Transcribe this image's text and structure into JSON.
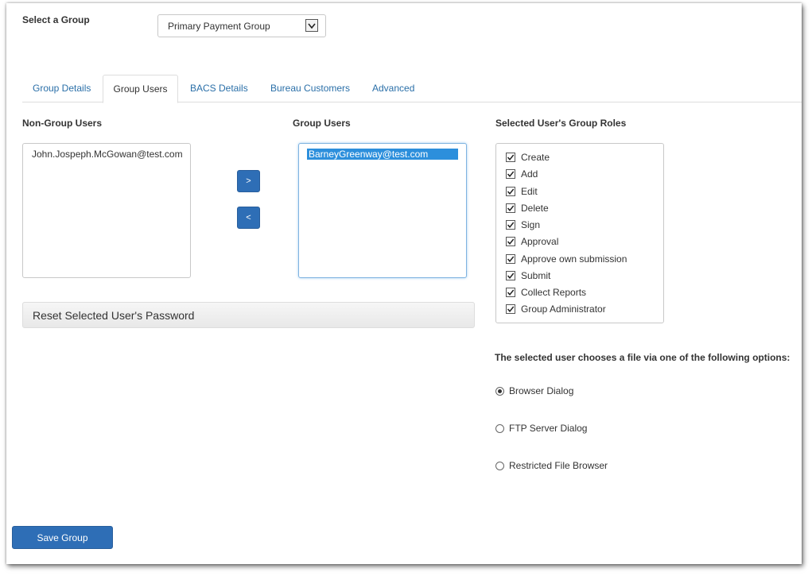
{
  "group_select": {
    "label": "Select a Group",
    "value": "Primary Payment Group"
  },
  "tabs": [
    {
      "label": "Group Details",
      "active": false
    },
    {
      "label": "Group Users",
      "active": true
    },
    {
      "label": "BACS Details",
      "active": false
    },
    {
      "label": "Bureau Customers",
      "active": false
    },
    {
      "label": "Advanced",
      "active": false
    }
  ],
  "non_group_users": {
    "heading": "Non-Group Users",
    "items": [
      "John.Jospeph.McGowan@test.com"
    ]
  },
  "move_buttons": {
    "add": ">",
    "remove": "<"
  },
  "group_users": {
    "heading": "Group Users",
    "items": [
      "BarneyGreenway@test.com"
    ],
    "selected_index": 0
  },
  "reset_password": {
    "label": "Reset Selected User's Password"
  },
  "roles": {
    "heading": "Selected User's Group Roles",
    "items": [
      {
        "label": "Create",
        "checked": true
      },
      {
        "label": "Add",
        "checked": true
      },
      {
        "label": "Edit",
        "checked": true
      },
      {
        "label": "Delete",
        "checked": true
      },
      {
        "label": "Sign",
        "checked": true
      },
      {
        "label": "Approval",
        "checked": true
      },
      {
        "label": "Approve own submission",
        "checked": true
      },
      {
        "label": "Submit",
        "checked": true
      },
      {
        "label": "Collect Reports",
        "checked": true
      },
      {
        "label": "Group Administrator",
        "checked": true
      }
    ]
  },
  "file_options": {
    "heading": "The selected user chooses a file via one of the following options:",
    "options": [
      {
        "label": "Browser Dialog",
        "selected": true
      },
      {
        "label": "FTP Server Dialog",
        "selected": false
      },
      {
        "label": "Restricted File Browser",
        "selected": false
      }
    ]
  },
  "save_button": {
    "label": "Save Group"
  },
  "colors": {
    "accent": "#2e6eb6",
    "link": "#2a6fa8",
    "selection": "#2c8fdc"
  },
  "icons": {
    "dropdown": "chevron-down-icon",
    "checkbox": "checkmark-icon",
    "radio": "radio-dot-icon"
  }
}
